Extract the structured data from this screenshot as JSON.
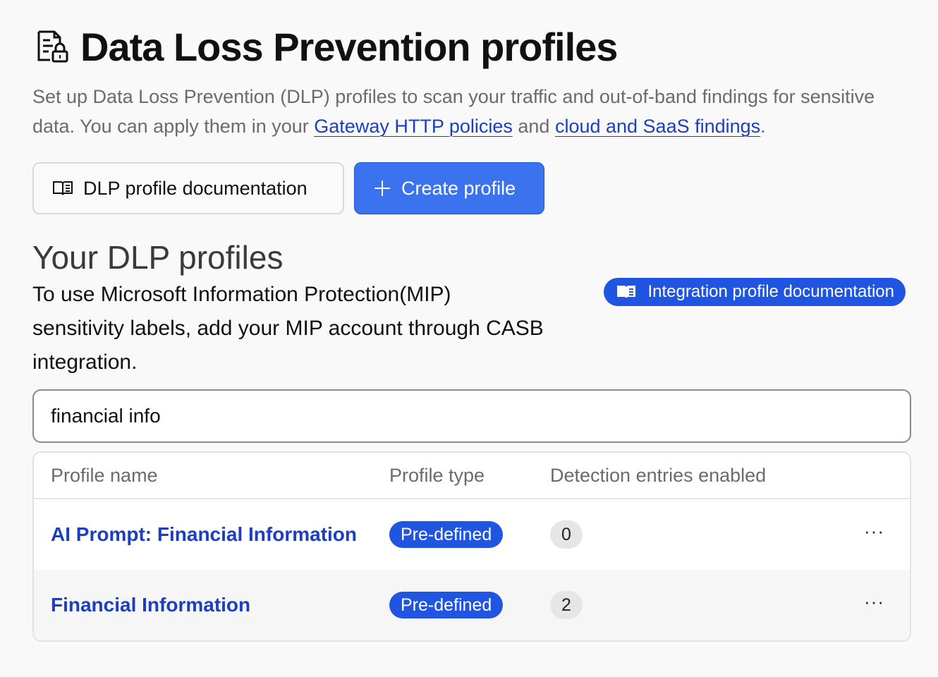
{
  "header": {
    "title": "Data Loss Prevention profiles",
    "icon": "document-lock-icon",
    "subtitle_prefix": "Set up Data Loss Prevention (DLP) profiles to scan your traffic and out-of-band findings for sensitive data. You can apply them in your ",
    "link1": "Gateway HTTP policies",
    "subtitle_middle": " and ",
    "link2": "cloud and SaaS findings",
    "subtitle_suffix": "."
  },
  "actions": {
    "docs_label": "DLP profile documentation",
    "docs_icon": "book-icon",
    "create_label": "Create profile",
    "create_icon": "plus-icon"
  },
  "profiles_section": {
    "title": "Your DLP profiles",
    "info_text": "To use Microsoft Information Protection(MIP) sensitivity labels, add your MIP account through CASB integration.",
    "integration_docs_label": "Integration profile documentation",
    "integration_docs_icon": "book-icon"
  },
  "search": {
    "value": "financial info",
    "placeholder": ""
  },
  "table": {
    "columns": {
      "name": "Profile name",
      "type": "Profile type",
      "count": "Detection entries enabled"
    },
    "rows": [
      {
        "name": "AI Prompt: Financial Information",
        "type": "Pre-defined",
        "count": "0",
        "menu": "···"
      },
      {
        "name": "Financial Information",
        "type": "Pre-defined",
        "count": "2",
        "menu": "···"
      }
    ]
  },
  "colors": {
    "primary": "#3b73ee",
    "badge": "#1f55e0",
    "link": "#1d3fbd"
  }
}
